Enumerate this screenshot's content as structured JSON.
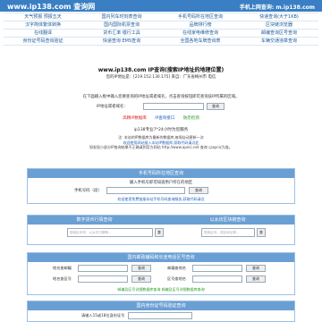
{
  "topbar": {
    "site": "www.ip138.com 查询网",
    "mobile": "手机上网查询: m.ip138.com"
  },
  "nav": [
    [
      "天气预报 预报五天",
      "国内列车时刻表查询",
      "手机号码所在地区查询",
      "快递查询(大于1KB)"
    ],
    [
      "汉字简体繁体转换",
      "国内国际机票查询",
      "品牌排行榜",
      "区块链浏览器"
    ],
    [
      "在线翻译",
      "货币汇率 银行工具",
      "在线家电维修查询",
      "邮编查询区号查询"
    ],
    [
      "身份证号码查询验证",
      "快递查询 EMS查询",
      "全国各地车牌查询表",
      "车辆交通违章查询"
    ]
  ],
  "main": {
    "title": "www.ip138.com IP查询(搜索IP地址的地理位置)",
    "your_ip": "您的IP地址是：[219.152.130.175] 来自：广东省梅州市 电信",
    "hint": "在下面输入框中输入您要查询的IP地址或者域名，点击查询按钮即可查询该IP所属的区域。",
    "ip_label": "IP地址或者域名：",
    "query_btn": "查询",
    "links": [
      "高精IP数据库",
      "IP查询接口",
      "防恐检测"
    ],
    "promo": "ip138专业7*24小时为您服务",
    "notes": [
      "注: 本站的IP数据库为最新的数据库,每周自动更新一次",
      "欢迎使用网站接入本站IP数据库,获取代码请点此",
      "如发现小部分IP查询结果不正确请到官方网站 http://www.apnic.net 查询 以apnic为准。"
    ]
  },
  "phone_panel": {
    "header": "手机号码所在地区查询",
    "sub": "输入手机号即可知道用户所在的地区",
    "label": "手机号码（段）",
    "btn": "查询",
    "footer": "欢迎使用免费链接本站手机号码查询服务,获取代码请点"
  },
  "exchange_panel": {
    "header_left": "数字货币行情查询",
    "header_right": "以太坊区块链查询",
    "placeholder_left": "搜索区块号、以太坊行情等...",
    "placeholder_right": "搜索区块、钱包地址等...",
    "btn": "查"
  },
  "postal_panel": {
    "header": "国内邮政编码和长途电话区号查询",
    "city_postal_label": "地名查邮编",
    "postal_city_label": "邮编查地名",
    "city_area_label": "地名查区号",
    "area_city_label": "区号查地名",
    "btn": "查询",
    "footer": "邮编及区号详细数据库查询 邮编及区号详细数据库查询"
  },
  "id_panel": {
    "header": "国内身份证号码验证查询",
    "label": "请输入15或18位身份证号"
  }
}
